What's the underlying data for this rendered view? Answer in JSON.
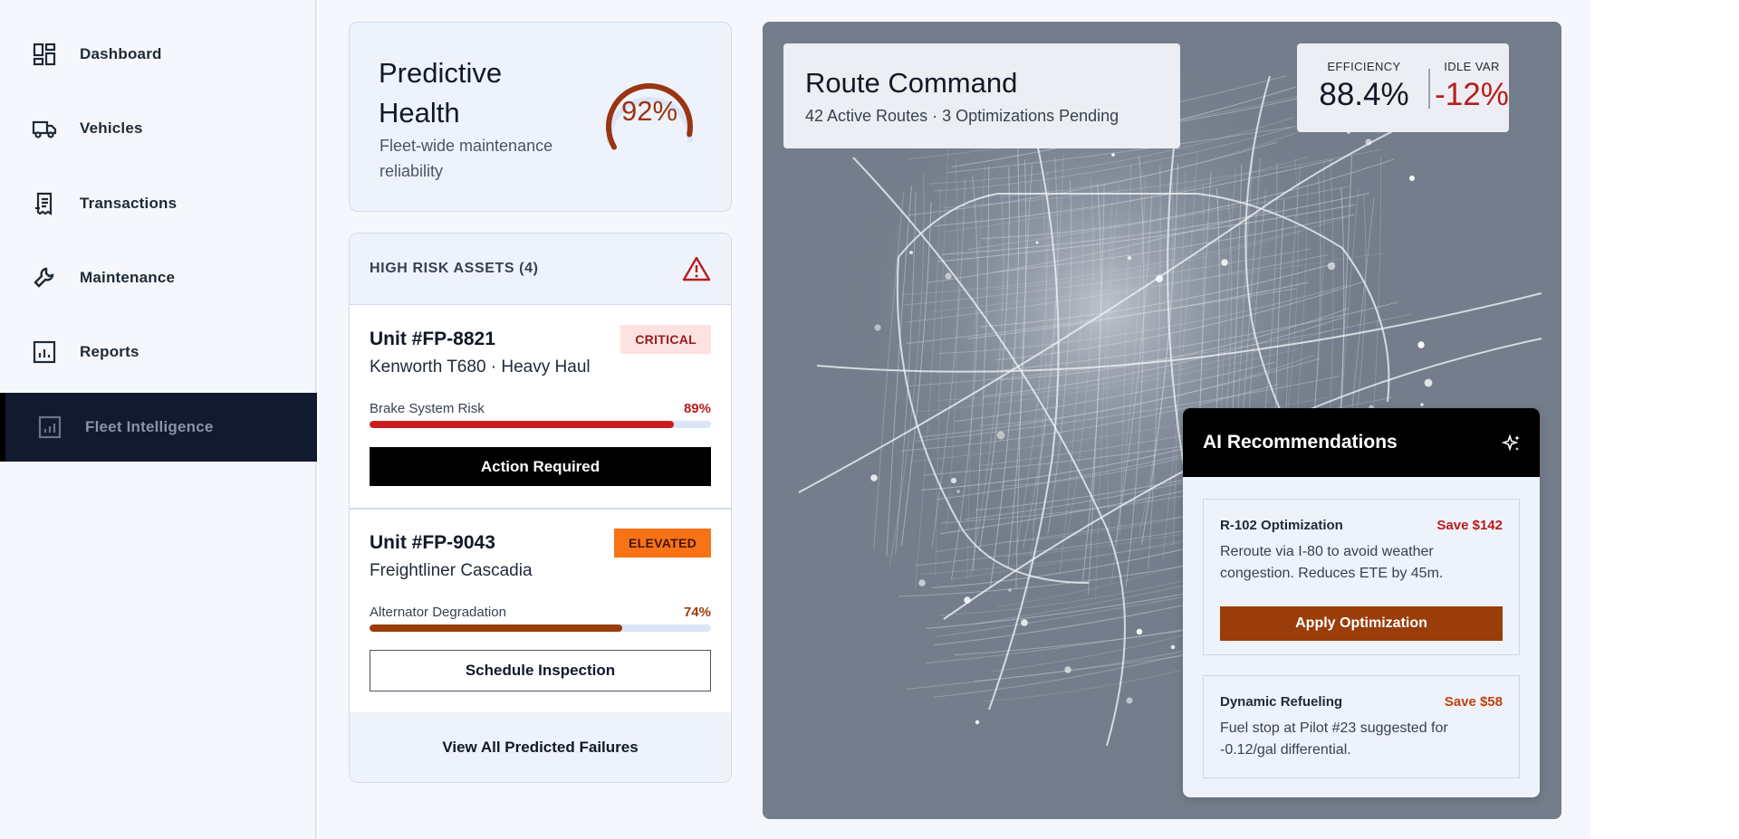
{
  "sidebar": {
    "items": [
      {
        "label": "Dashboard",
        "icon": "dashboard-icon",
        "active": false
      },
      {
        "label": "Vehicles",
        "icon": "truck-icon",
        "active": false
      },
      {
        "label": "Transactions",
        "icon": "receipt-icon",
        "active": false
      },
      {
        "label": "Maintenance",
        "icon": "wrench-icon",
        "active": false
      },
      {
        "label": "Reports",
        "icon": "bar-chart-icon",
        "active": false
      },
      {
        "label": "Fleet Intelligence",
        "icon": "analytics-icon",
        "active": true
      }
    ]
  },
  "health": {
    "title": "Predictive Health",
    "subtitle": "Fleet-wide maintenance reliability",
    "value": "92%",
    "fraction": 0.92,
    "color": "#9a3412"
  },
  "risk": {
    "title": "HIGH RISK ASSETS (4)",
    "assets": [
      {
        "unit": "Unit #FP-8821",
        "model": "Kenworth T680 · Heavy Haul",
        "badge": "CRITICAL",
        "metric_label": "Brake System Risk",
        "metric_value": "89%",
        "fraction": 0.89,
        "color": "#c81e1e",
        "action": "Action Required"
      },
      {
        "unit": "Unit #FP-9043",
        "model": "Freightliner Cascadia",
        "badge": "ELEVATED",
        "metric_label": "Alternator Degradation",
        "metric_value": "74%",
        "fraction": 0.74,
        "color": "#9a3d0a",
        "action": "Schedule Inspection"
      }
    ],
    "footer": "View All Predicted Failures"
  },
  "route": {
    "title": "Route Command",
    "subtitle": "42 Active Routes · 3 Optimizations Pending"
  },
  "kpis": {
    "efficiency_label": "EFFICIENCY",
    "efficiency_value": "88.4%",
    "idle_label": "IDLE VAR",
    "idle_value": "-12%",
    "idle_color": "#b91c1c"
  },
  "ai": {
    "title": "AI Recommendations",
    "recs": [
      {
        "title": "R-102 Optimization",
        "save": "Save $142",
        "body": "Reroute via I-80 to avoid weather congestion. Reduces ETE by 45m.",
        "action": "Apply Optimization",
        "save_color": "#b91c1c"
      },
      {
        "title": "Dynamic Refueling",
        "save": "Save $58",
        "body": "Fuel stop at Pilot #23 suggested for -0.12/gal differential.",
        "save_color": "#c2410c"
      }
    ]
  }
}
